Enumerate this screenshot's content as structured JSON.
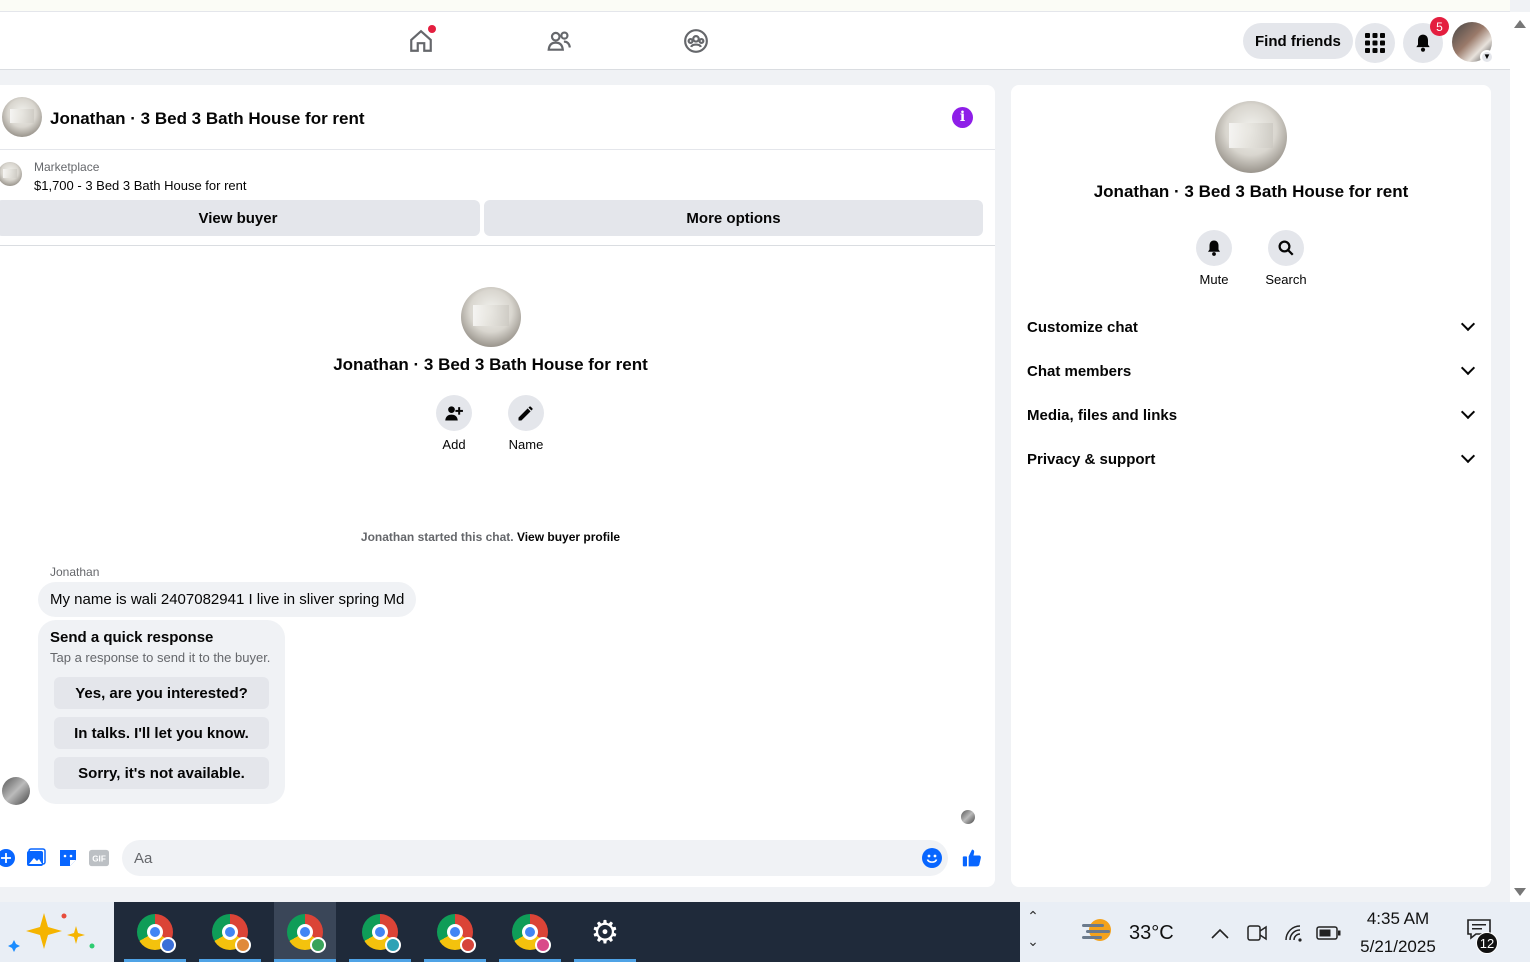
{
  "nav": {
    "find_friends": "Find friends",
    "notification_count": "5",
    "icons": [
      "home-icon",
      "friends-icon",
      "groups-icon",
      "apps-grid-icon",
      "bell-icon"
    ]
  },
  "chat": {
    "title": "Jonathan · 3 Bed 3 Bath House for rent",
    "marketplace_label": "Marketplace",
    "listing": "$1,700 - 3 Bed 3 Bath House for rent",
    "view_buyer": "View buyer",
    "more_options": "More options",
    "center_title": "Jonathan · 3 Bed 3 Bath House for rent",
    "add_label": "Add",
    "name_label": "Name",
    "started_text": "Jonathan started this chat.",
    "view_buyer_profile": "View buyer profile",
    "sender": "Jonathan",
    "message": "My name is wali 2407082941 I live in sliver spring Md",
    "quick_title": "Send a quick response",
    "quick_subtitle": "Tap a response to send it to the buyer.",
    "quick_responses": [
      "Yes, are you interested?",
      "In talks. I'll let you know.",
      "Sorry, it's not available."
    ],
    "input_placeholder": "Aa"
  },
  "side": {
    "title": "Jonathan · 3 Bed 3 Bath House for rent",
    "mute": "Mute",
    "search": "Search",
    "rows": [
      "Customize chat",
      "Chat members",
      "Media, files and links",
      "Privacy & support"
    ]
  },
  "taskbar": {
    "temperature": "33°C",
    "time": "4:35 AM",
    "date": "5/21/2025",
    "notification_count": "12"
  },
  "colors": {
    "accent_blue": "#0866ff",
    "info_purple": "#8e1ee8",
    "badge_red": "#e41e3f"
  }
}
